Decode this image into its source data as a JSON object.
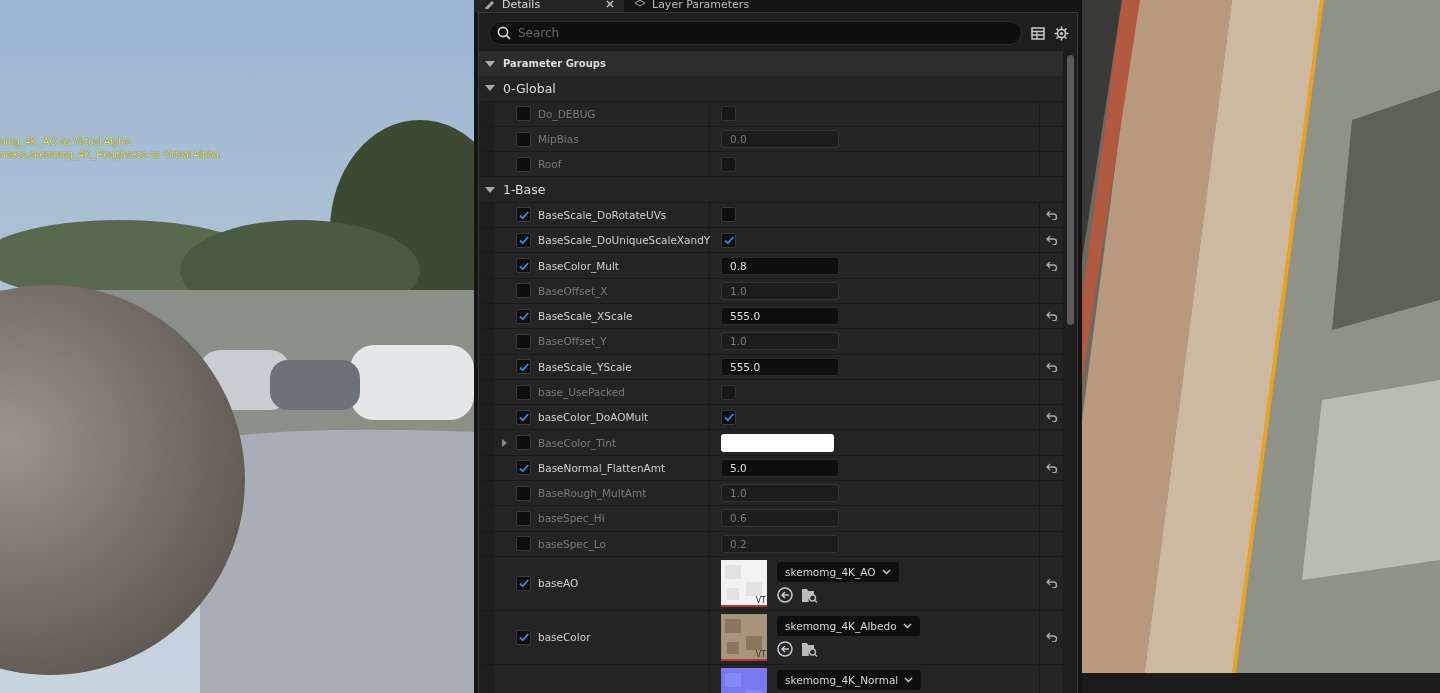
{
  "viewport_left": {
    "log_lines": [
      "omg_4K_AO as Virtual Alpha.",
      "nness.skemomg_4K_Roughness as Virtual Alpha."
    ]
  },
  "tabs": [
    {
      "label": "Details",
      "selected": true,
      "closable": true
    },
    {
      "label": "Layer Parameters",
      "selected": false,
      "closable": false
    }
  ],
  "search": {
    "placeholder": "Search"
  },
  "header": {
    "label": "Parameter Groups",
    "expanded": true
  },
  "groups": [
    {
      "label": "0-Global",
      "expanded": true,
      "params": [
        {
          "name": "Do_DEBUG",
          "enabled": false,
          "kind": "bool",
          "checked": false,
          "resettable": false
        },
        {
          "name": "MipBias",
          "enabled": false,
          "kind": "number",
          "value": "0.0",
          "resettable": false
        },
        {
          "name": "Roof",
          "enabled": false,
          "kind": "bool",
          "checked": false,
          "resettable": false
        }
      ]
    },
    {
      "label": "1-Base",
      "expanded": true,
      "params": [
        {
          "name": "BaseScale_DoRotateUVs",
          "enabled": true,
          "kind": "bool",
          "checked": false,
          "resettable": true
        },
        {
          "name": "BaseScale_DoUniqueScaleXandY",
          "enabled": true,
          "kind": "bool",
          "checked": true,
          "resettable": true
        },
        {
          "name": "BaseColor_Mult",
          "enabled": true,
          "kind": "number",
          "value": "0.8",
          "resettable": true
        },
        {
          "name": "BaseOffset_X",
          "enabled": false,
          "kind": "number",
          "value": "1.0",
          "resettable": false
        },
        {
          "name": "BaseScale_XScale",
          "enabled": true,
          "kind": "number",
          "value": "555.0",
          "resettable": true
        },
        {
          "name": "BaseOffset_Y",
          "enabled": false,
          "kind": "number",
          "value": "1.0",
          "resettable": false
        },
        {
          "name": "BaseScale_YScale",
          "enabled": true,
          "kind": "number",
          "value": "555.0",
          "resettable": true
        },
        {
          "name": "base_UsePacked",
          "enabled": false,
          "kind": "bool",
          "checked": false,
          "resettable": false
        },
        {
          "name": "baseColor_DoAOMult",
          "enabled": true,
          "kind": "bool",
          "checked": true,
          "resettable": true
        },
        {
          "name": "BaseColor_Tint",
          "enabled": false,
          "kind": "color",
          "color": "#ffffff",
          "expanded": false,
          "resettable": false
        },
        {
          "name": "BaseNormal_FlattenAmt",
          "enabled": true,
          "kind": "number",
          "value": "5.0",
          "resettable": true
        },
        {
          "name": "BaseRough_MultAmt",
          "enabled": false,
          "kind": "number",
          "value": "1.0",
          "resettable": false
        },
        {
          "name": "baseSpec_Hi",
          "enabled": false,
          "kind": "number",
          "value": "0.6",
          "resettable": false
        },
        {
          "name": "baseSpec_Lo",
          "enabled": false,
          "kind": "number",
          "value": "0.2",
          "resettable": false
        },
        {
          "name": "baseAO",
          "enabled": true,
          "kind": "texture",
          "asset": "skemomg_4K_AO",
          "badge": "VT",
          "asset_actions": true,
          "resettable": true
        },
        {
          "name": "baseColor",
          "enabled": true,
          "kind": "texture",
          "asset": "skemomg_4K_Albedo",
          "badge": "VT",
          "asset_actions": true,
          "resettable": true
        },
        {
          "kind": "texture",
          "asset": "skemomg_4K_Normal",
          "asset_actions": false,
          "resettable": false
        }
      ]
    }
  ]
}
